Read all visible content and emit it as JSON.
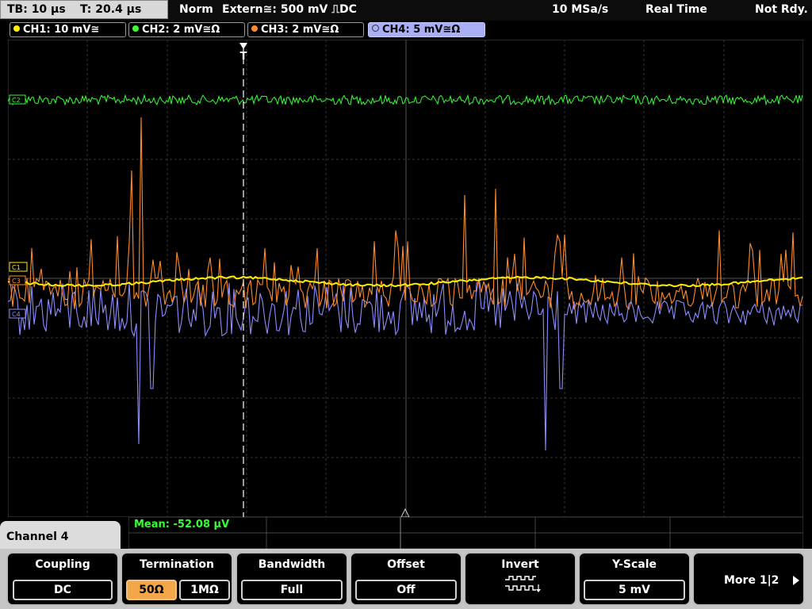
{
  "topbar": {
    "timebase": "TB: 10 µs",
    "trigger_time": "T: 20.4 µs",
    "trigger_mode": "Norm",
    "trigger_source": "Extern≅: 500 mV ⎍DC",
    "sample_rate": "10 MSa/s",
    "acq_mode": "Real Time",
    "status": "Not Rdy."
  },
  "channels": [
    {
      "label": "CH1: 10 mV≅",
      "color": "#ffee00"
    },
    {
      "label": "CH2: 2 mV≅Ω",
      "color": "#33ff33"
    },
    {
      "label": "CH3: 2 mV≅Ω",
      "color": "#ff8a2a"
    },
    {
      "label": "CH4: 5 mV≅Ω",
      "color": "#9a9aff"
    }
  ],
  "markers": {
    "trigger": "T",
    "ch2": "C2",
    "ch1": "C1",
    "ch3": "C3",
    "ch4": "C4"
  },
  "measurement": {
    "text": "Mean: -52.08 µV"
  },
  "menu": {
    "title": "Channel 4",
    "coupling": {
      "title": "Coupling",
      "value": "DC"
    },
    "termination": {
      "title": "Termination",
      "opt1": "50Ω",
      "opt2": "1MΩ",
      "selected": "50Ω"
    },
    "bandwidth": {
      "title": "Bandwidth",
      "value": "Full"
    },
    "offset": {
      "title": "Offset",
      "value": "Off"
    },
    "invert": {
      "title": "Invert",
      "icon": "square-wave-invert-icon"
    },
    "yscale": {
      "title": "Y-Scale",
      "value": "5 mV"
    },
    "more": {
      "label": "More 1|2",
      "icon": "arrow-right-icon"
    }
  }
}
